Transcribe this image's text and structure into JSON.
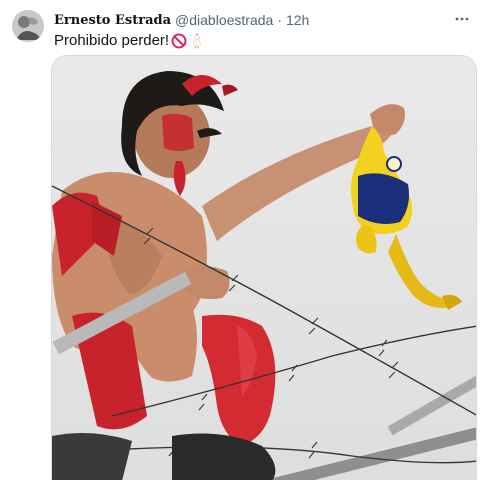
{
  "tweet": {
    "author": {
      "display_name": "Ernesto Estrada",
      "handle": "@diabloestrada",
      "separator": "·",
      "time": "12h"
    },
    "text": "Prohibido perder!",
    "emojis": [
      "no-entry-sign-icon",
      "chicken-icon"
    ],
    "more_icon": "more-dots-icon"
  },
  "colors": {
    "text_primary": "#0f1419",
    "text_secondary": "#536471",
    "media_border": "#cfd9de"
  }
}
